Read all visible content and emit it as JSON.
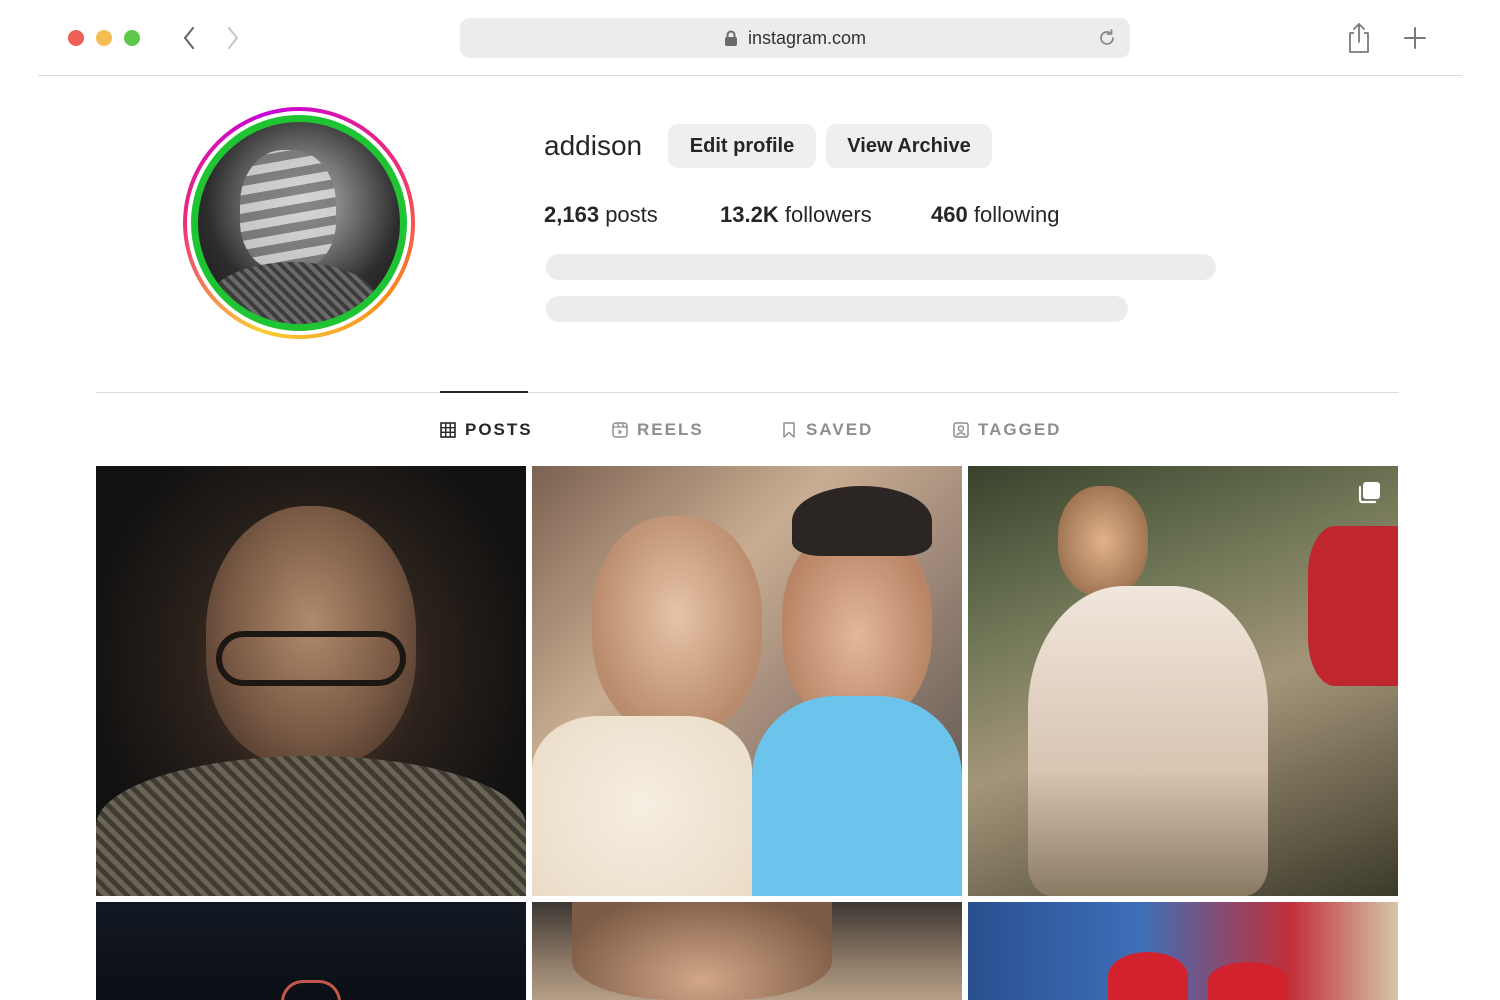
{
  "browser": {
    "url": "instagram.com",
    "icons": {
      "back": "chevron-left-icon",
      "forward": "chevron-right-icon",
      "lock": "lock-icon",
      "reload": "reload-icon",
      "share": "share-icon",
      "new_tab": "plus-icon"
    }
  },
  "profile": {
    "username": "addison",
    "edit_profile_label": "Edit profile",
    "view_archive_label": "View Archive",
    "stats": {
      "posts_count": "2,163",
      "posts_label": "posts",
      "followers_count": "13.2K",
      "followers_label": "followers",
      "following_count": "460",
      "following_label": "following"
    }
  },
  "tabs": [
    {
      "label": "POSTS",
      "icon": "grid-icon",
      "active": true
    },
    {
      "label": "REELS",
      "icon": "reels-icon",
      "active": false
    },
    {
      "label": "SAVED",
      "icon": "bookmark-icon",
      "active": false
    },
    {
      "label": "TAGGED",
      "icon": "tagged-icon",
      "active": false
    }
  ],
  "colors": {
    "story_ring_green": "#1ec431",
    "traffic_red": "#ee5f57",
    "traffic_yellow": "#f5bd4f",
    "traffic_green": "#5ec84b"
  }
}
